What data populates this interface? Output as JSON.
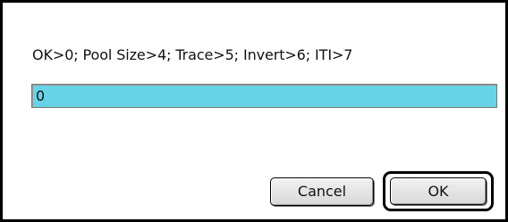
{
  "dialog": {
    "prompt": "OK>0; Pool Size>4; Trace>5; Invert>6; ITI>7",
    "input_value": "0",
    "cancel_label": "Cancel",
    "ok_label": "OK"
  },
  "colors": {
    "input_background": "#66d4e6",
    "dialog_border": "#000000"
  }
}
